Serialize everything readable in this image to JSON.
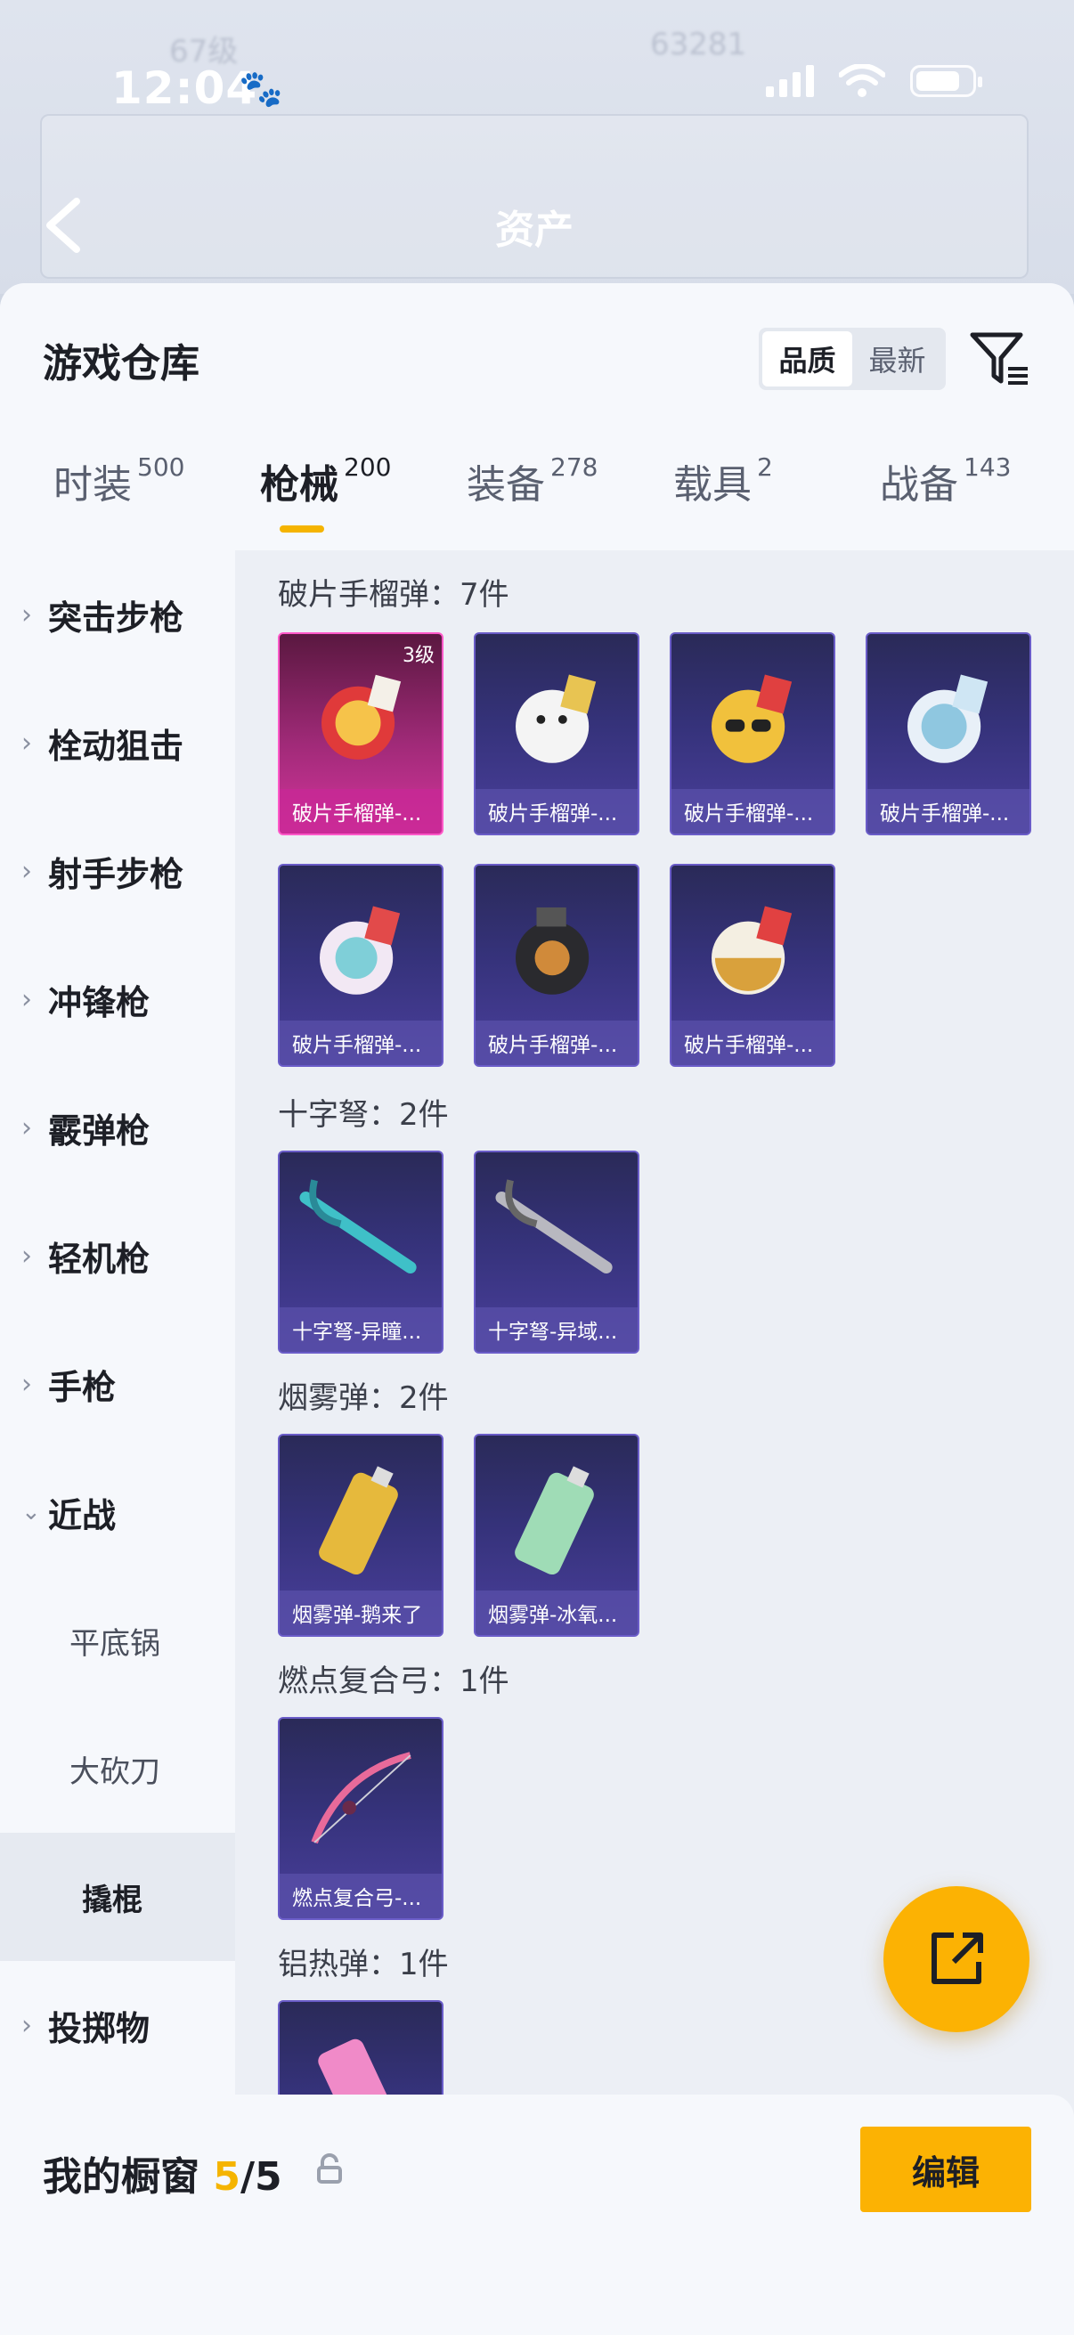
{
  "status_bar": {
    "time": "12:04"
  },
  "header": {
    "title": "资产"
  },
  "sheet": {
    "title": "游戏仓库",
    "sort_options": [
      {
        "label": "品质",
        "active": true
      },
      {
        "label": "最新",
        "active": false
      }
    ]
  },
  "tabs": [
    {
      "label": "时装",
      "count": "500"
    },
    {
      "label": "枪械",
      "count": "200",
      "active": true
    },
    {
      "label": "装备",
      "count": "278"
    },
    {
      "label": "载具",
      "count": "2"
    },
    {
      "label": "战备",
      "count": "143"
    }
  ],
  "sidebar": {
    "items": [
      {
        "label": "突击步枪",
        "expanded": false
      },
      {
        "label": "栓动狙击",
        "expanded": false
      },
      {
        "label": "射手步枪",
        "expanded": false
      },
      {
        "label": "冲锋枪",
        "expanded": false
      },
      {
        "label": "霰弹枪",
        "expanded": false
      },
      {
        "label": "轻机枪",
        "expanded": false
      },
      {
        "label": "手枪",
        "expanded": false
      },
      {
        "label": "近战",
        "expanded": true
      },
      {
        "label": "平底锅",
        "sub": true
      },
      {
        "label": "大砍刀",
        "sub": true
      },
      {
        "label": "撬棍",
        "sub": true,
        "selected": true
      },
      {
        "label": "投掷物",
        "expanded": false
      }
    ]
  },
  "sections": [
    {
      "title": "破片手榴弹：7件",
      "items": [
        {
          "name": "破片手榴弹-...",
          "level": "3级",
          "rarity": "gold"
        },
        {
          "name": "破片手榴弹-..."
        },
        {
          "name": "破片手榴弹-..."
        },
        {
          "name": "破片手榴弹-..."
        },
        {
          "name": "破片手榴弹-..."
        },
        {
          "name": "破片手榴弹-..."
        },
        {
          "name": "破片手榴弹-..."
        }
      ]
    },
    {
      "title": "十字弩：2件",
      "items": [
        {
          "name": "十字弩-异瞳..."
        },
        {
          "name": "十字弩-异域..."
        }
      ]
    },
    {
      "title": "烟雾弹：2件",
      "items": [
        {
          "name": "烟雾弹-鹅来了"
        },
        {
          "name": "烟雾弹-冰氧..."
        }
      ]
    },
    {
      "title": "燃点复合弓：1件",
      "items": [
        {
          "name": "燃点复合弓-..."
        }
      ]
    },
    {
      "title": "铝热弹：1件",
      "items": [
        {
          "name": ""
        }
      ]
    }
  ],
  "bottom_bar": {
    "label": "我的橱窗",
    "count_current": "5",
    "count_sep_total": "/5",
    "edit_label": "编辑"
  },
  "colors": {
    "accent": "#fcb203",
    "card_purple": "#35327a",
    "card_gold_pink": "#d4359c"
  },
  "icons": [
    "back-icon",
    "filter-icon",
    "chevron-right-icon",
    "chevron-down-icon",
    "share-icon",
    "lock-icon"
  ]
}
